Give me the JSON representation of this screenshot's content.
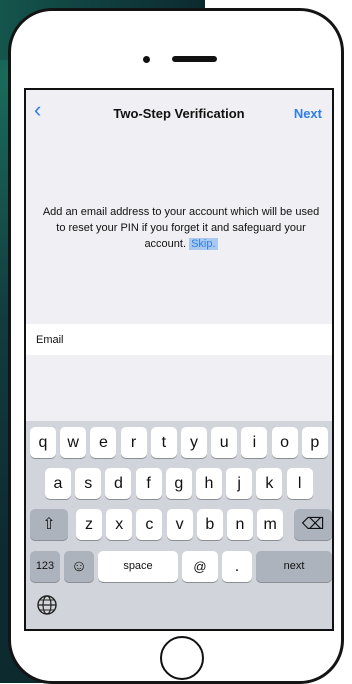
{
  "nav": {
    "back_icon": "‹",
    "title": "Two-Step Verification",
    "next": "Next"
  },
  "description": {
    "text": "Add an email address to your account which will be used to reset your PIN if you forget it and safeguard your account.",
    "skip": "Skip."
  },
  "email": {
    "label": "Email"
  },
  "keyboard": {
    "row1": [
      "q",
      "w",
      "e",
      "r",
      "t",
      "y",
      "u",
      "i",
      "o",
      "p"
    ],
    "row2": [
      "a",
      "s",
      "d",
      "f",
      "g",
      "h",
      "j",
      "k",
      "l"
    ],
    "row3": [
      "z",
      "x",
      "c",
      "v",
      "b",
      "n",
      "m"
    ],
    "shift_icon": "⇧",
    "delete_icon": "⌫",
    "numbers": "123",
    "emoji_icon": "☺",
    "space": "space",
    "at": "@",
    "dot": ".",
    "next": "next",
    "globe_icon": "globe-icon"
  },
  "colors": {
    "accent": "#2f7fe6",
    "screen_bg": "#efeff4",
    "keyboard_bg": "#d1d5db",
    "skip_highlight": "#aac9f0"
  }
}
